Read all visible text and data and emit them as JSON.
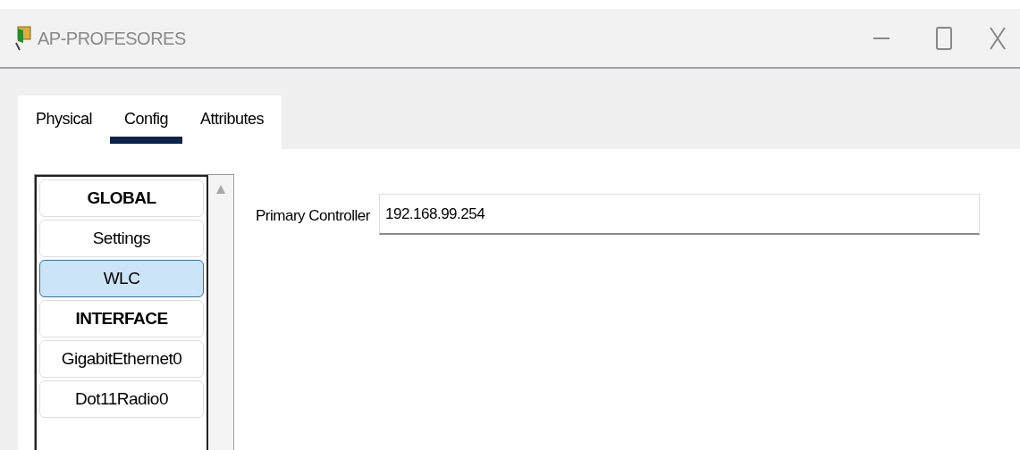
{
  "window": {
    "title": "AP-PROFESORES"
  },
  "tabs": [
    {
      "label": "Physical",
      "selected": false
    },
    {
      "label": "Config",
      "selected": true
    },
    {
      "label": "Attributes",
      "selected": false
    }
  ],
  "sidebar": {
    "items": [
      {
        "kind": "heading",
        "label": "GLOBAL",
        "selected": false
      },
      {
        "kind": "item",
        "label": "Settings",
        "selected": false
      },
      {
        "kind": "item",
        "label": "WLC",
        "selected": true
      },
      {
        "kind": "heading",
        "label": "INTERFACE",
        "selected": false
      },
      {
        "kind": "item",
        "label": "GigabitEthernet0",
        "selected": false
      },
      {
        "kind": "item",
        "label": "Dot11Radio0",
        "selected": false
      }
    ]
  },
  "form": {
    "label": "Primary Controller",
    "value": "192.168.99.254"
  }
}
